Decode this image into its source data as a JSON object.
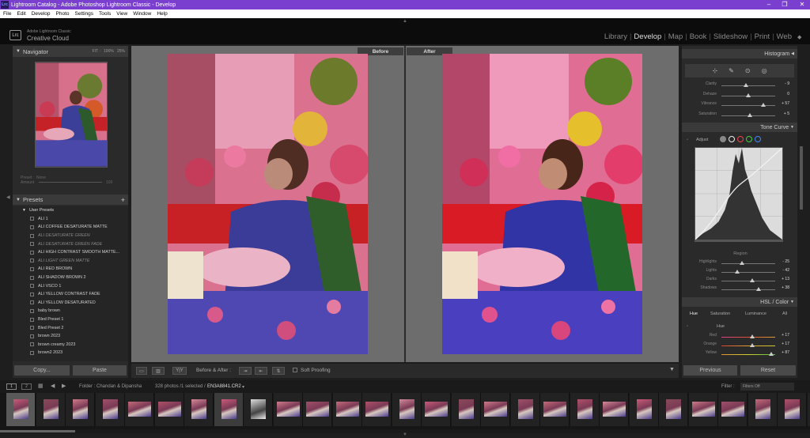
{
  "window": {
    "title": "Lightroom Catalog - Adobe Photoshop Lightroom Classic - Develop",
    "icon": "Lrc"
  },
  "menu": [
    "File",
    "Edit",
    "Develop",
    "Photo",
    "Settings",
    "Tools",
    "View",
    "Window",
    "Help"
  ],
  "identity": {
    "logo": "Lrc",
    "line1": "Adobe Lightroom Classic",
    "line2": "Creative Cloud"
  },
  "modules": [
    "Library",
    "Develop",
    "Map",
    "Book",
    "Slideshow",
    "Print",
    "Web"
  ],
  "active_module": "Develop",
  "navigator": {
    "title": "Navigator",
    "zoom": [
      "FIT :",
      "100%",
      "25%"
    ]
  },
  "snapshot": {
    "preset_label": "Preset :",
    "preset_value": "None",
    "amount_label": "Amount",
    "amount_value": "100"
  },
  "presets": {
    "title": "Presets",
    "group": "User Presets",
    "items": [
      {
        "label": "ALI 1",
        "dim": false
      },
      {
        "label": "ALI COFFEE DESATURATE MATTE",
        "dim": false
      },
      {
        "label": "ALI DESATURATE GREEN",
        "dim": true
      },
      {
        "label": "ALI DESATURATE GREEN FADE",
        "dim": true
      },
      {
        "label": "ALI HIGH CONTRAST SMOOTH MATTE...",
        "dim": false
      },
      {
        "label": "ALI LIGHT GREEN MATTE",
        "dim": true
      },
      {
        "label": "ALI RED BROWN",
        "dim": false
      },
      {
        "label": "ALI SHADOW BROWN 2",
        "dim": false
      },
      {
        "label": "ALI VSCO 1",
        "dim": false
      },
      {
        "label": "ALI YELLOW CONTRAST FADE",
        "dim": false
      },
      {
        "label": "ALI YELLOW DESATURATED",
        "dim": false
      },
      {
        "label": "baby brown",
        "dim": false
      },
      {
        "label": "Bled Preset 1",
        "dim": false
      },
      {
        "label": "Bled Preset 2",
        "dim": false
      },
      {
        "label": "brown 2023",
        "dim": false
      },
      {
        "label": "brown creamy 2023",
        "dim": false
      },
      {
        "label": "brown2 2023",
        "dim": false
      }
    ]
  },
  "left_buttons": {
    "copy": "Copy...",
    "paste": "Paste"
  },
  "view_labels": {
    "before": "Before",
    "after": "After"
  },
  "toolbar": {
    "before_after": "Before & After :",
    "soft_proofing": "Soft Proofing",
    "yy": "Y|Y"
  },
  "right": {
    "histogram": "Histogram",
    "presence": [
      {
        "name": "Clarity",
        "value": "- 9",
        "pos": 0.46
      },
      {
        "name": "Dehaze",
        "value": "0",
        "pos": 0.5
      },
      {
        "name": "Vibrance",
        "value": "+ 57",
        "pos": 0.78
      },
      {
        "name": "Saturation",
        "value": "+ 5",
        "pos": 0.53
      }
    ],
    "tone_curve": "Tone Curve",
    "adjust": "Adjust",
    "region": "Region",
    "regions": [
      {
        "name": "Highlights",
        "value": "- 25",
        "pos": 0.38
      },
      {
        "name": "Lights",
        "value": "- 42",
        "pos": 0.29
      },
      {
        "name": "Darks",
        "value": "+ 13",
        "pos": 0.57
      },
      {
        "name": "Shadows",
        "value": "+ 38",
        "pos": 0.69
      }
    ],
    "hsl": "HSL / Color",
    "hsl_tabs": [
      "Hue",
      "Saturation",
      "Luminance",
      "All"
    ],
    "hue_title": "Hue",
    "hue_rows": [
      {
        "name": "Red",
        "value": "+ 17",
        "pos": 0.58
      },
      {
        "name": "Orange",
        "value": "+ 17",
        "pos": 0.58
      },
      {
        "name": "Yellow",
        "value": "+ 87",
        "pos": 0.93
      }
    ],
    "previous": "Previous",
    "reset": "Reset"
  },
  "filmstrip": {
    "folder": "Folder : Chandan & Dipansha",
    "count": "328 photos /1 selected /",
    "file": "EN3A8841.CR2",
    "filter_label": "Filter :",
    "filter_value": "Filters Off",
    "view1": "1",
    "view2": "2"
  }
}
